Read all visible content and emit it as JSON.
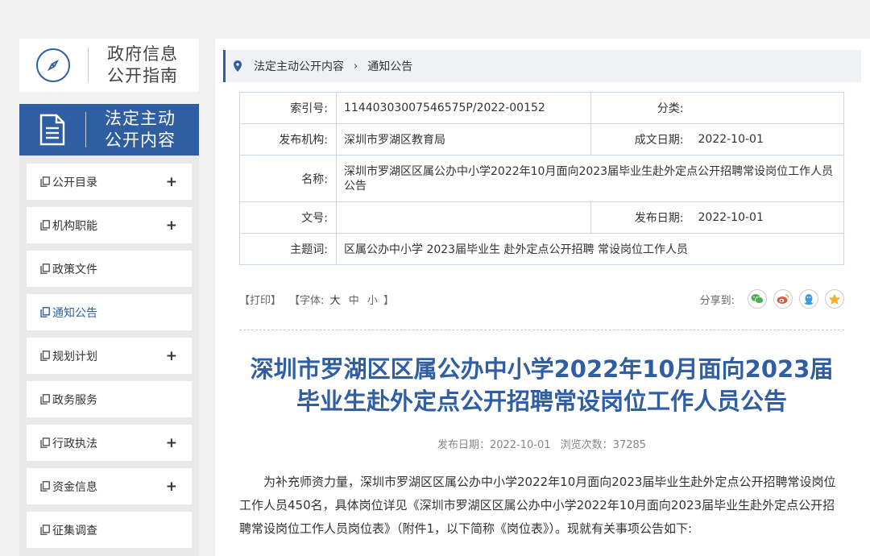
{
  "sidebar": {
    "guide_line1": "政府信息",
    "guide_line2": "公开指南",
    "active_line1": "法定主动",
    "active_line2": "公开内容",
    "items": [
      {
        "label": "公开目录",
        "plus": "+"
      },
      {
        "label": "机构职能",
        "plus": "+"
      },
      {
        "label": "政策文件",
        "plus": ""
      },
      {
        "label": "通知公告",
        "plus": ""
      },
      {
        "label": "规划计划",
        "plus": "+"
      },
      {
        "label": "政务服务",
        "plus": ""
      },
      {
        "label": "行政执法",
        "plus": "+"
      },
      {
        "label": "资金信息",
        "plus": "+"
      },
      {
        "label": "征集调查",
        "plus": ""
      }
    ]
  },
  "breadcrumb": {
    "level1": "法定主动公开内容",
    "separator": "›",
    "level2": "通知公告"
  },
  "info": {
    "index_label": "索引号:",
    "index_value": "11440303007546575P/2022-00152",
    "category_label": "分类:",
    "category_value": "",
    "publisher_label": "发布机构:",
    "publisher_value": "深圳市罗湖区教育局",
    "created_label": "成文日期:",
    "created_value": "2022-10-01",
    "name_label": "名称:",
    "name_value": "深圳市罗湖区区属公办中小学2022年10月面向2023届毕业生赴外定点公开招聘常设岗位工作人员公告",
    "docno_label": "文号:",
    "docno_value": "",
    "pubdate_label": "发布日期:",
    "pubdate_value": "2022-10-01",
    "keywords_label": "主题词:",
    "keywords_value": "区属公办中小学 2023届毕业生 赴外定点公开招聘 常设岗位工作人员"
  },
  "tools": {
    "print": "【打印】",
    "font_prefix": "【字体:",
    "font_big": "大",
    "font_mid": "中",
    "font_small": "小",
    "font_suffix": "】",
    "share_label": "分享到:"
  },
  "article": {
    "title": "深圳市罗湖区区属公办中小学2022年10月面向2023届毕业生赴外定点公开招聘常设岗位工作人员公告",
    "pubdate": "发布日期：2022-10-01",
    "views": "浏览次数：37285",
    "paragraph": "为补充师资力量，深圳市罗湖区区属公办中小学2022年10月面向2023届毕业生赴外定点公开招聘常设岗位工作人员450名，具体岗位详见《深圳市罗湖区区属公办中小学2022年10月面向2023届毕业生赴外定点公开招聘常设岗位工作人员岗位表》（附件1，以下简称《岗位表》）。现就有关事项公告如下:"
  },
  "colors": {
    "accent": "#2f5ea2",
    "wechat": "#4caf50",
    "weibo": "#e2543a",
    "qq": "#3b9be0",
    "qzone": "#f0b22c"
  }
}
